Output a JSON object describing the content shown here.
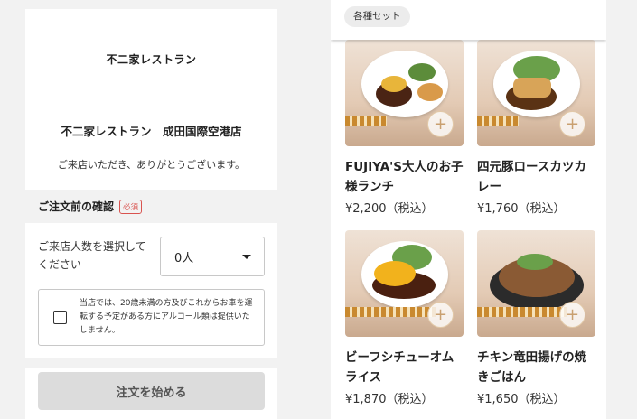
{
  "store": {
    "logo_text": "不二家レストラン",
    "name": "不二家レストラン　成田国際空港店",
    "welcome": "ご来店いただき、ありがとうございます。"
  },
  "confirm": {
    "title": "ご注文前の確認",
    "required_badge": "必須",
    "count_label": "ご来店人数を選択してください",
    "count_value": "0人",
    "alcohol_notice": "当店では、20歳未満の方及びこれからお車を運転する予定がある方にアルコール類は提供いたしません。",
    "start_button": "注文を始める"
  },
  "menu": {
    "category_chip": "各種セット",
    "add_symbol": "+",
    "items": [
      {
        "name": "FUJIYA'S大人のお子様ランチ",
        "price": "¥2,200（税込）"
      },
      {
        "name": "四元豚ロースカツカレー",
        "price": "¥1,760（税込）"
      },
      {
        "name": "ビーフシチューオムライス",
        "price": "¥1,870（税込）"
      },
      {
        "name": "チキン竜田揚げの焼きごはん",
        "price": "¥1,650（税込）"
      }
    ]
  },
  "colors": {
    "required_red": "#d9534f",
    "button_gray": "#dcdcdc",
    "plus_accent": "#c9a070"
  }
}
